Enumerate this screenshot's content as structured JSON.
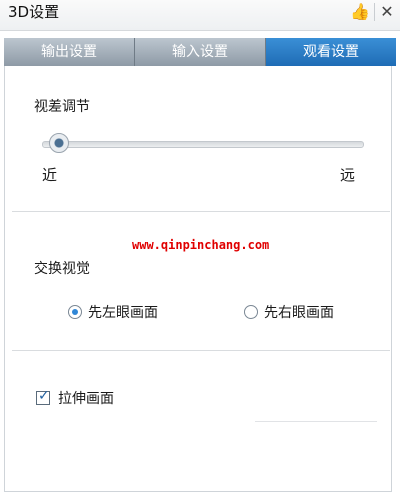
{
  "window": {
    "title": "3D设置",
    "icons": {
      "feedback": "thumbs-up-icon",
      "close": "close-icon"
    }
  },
  "tabs": [
    {
      "label": "输出设置",
      "active": false
    },
    {
      "label": "输入设置",
      "active": false
    },
    {
      "label": "观看设置",
      "active": true
    }
  ],
  "parallax": {
    "heading": "视差调节",
    "min_label": "近",
    "max_label": "远",
    "value_fraction": 0.03
  },
  "watermark": "www.qinpinchang.com",
  "swap_view": {
    "heading": "交换视觉",
    "options": [
      {
        "label": "先左眼画面",
        "selected": true
      },
      {
        "label": "先右眼画面",
        "selected": false
      }
    ]
  },
  "stretch": {
    "label": "拉伸画面",
    "checked": true
  },
  "colors": {
    "active_tab": "#2a7cc7",
    "inactive_tab": "#a9b4bf",
    "watermark": "#e00000",
    "radio_selected": "#2f86d6"
  }
}
